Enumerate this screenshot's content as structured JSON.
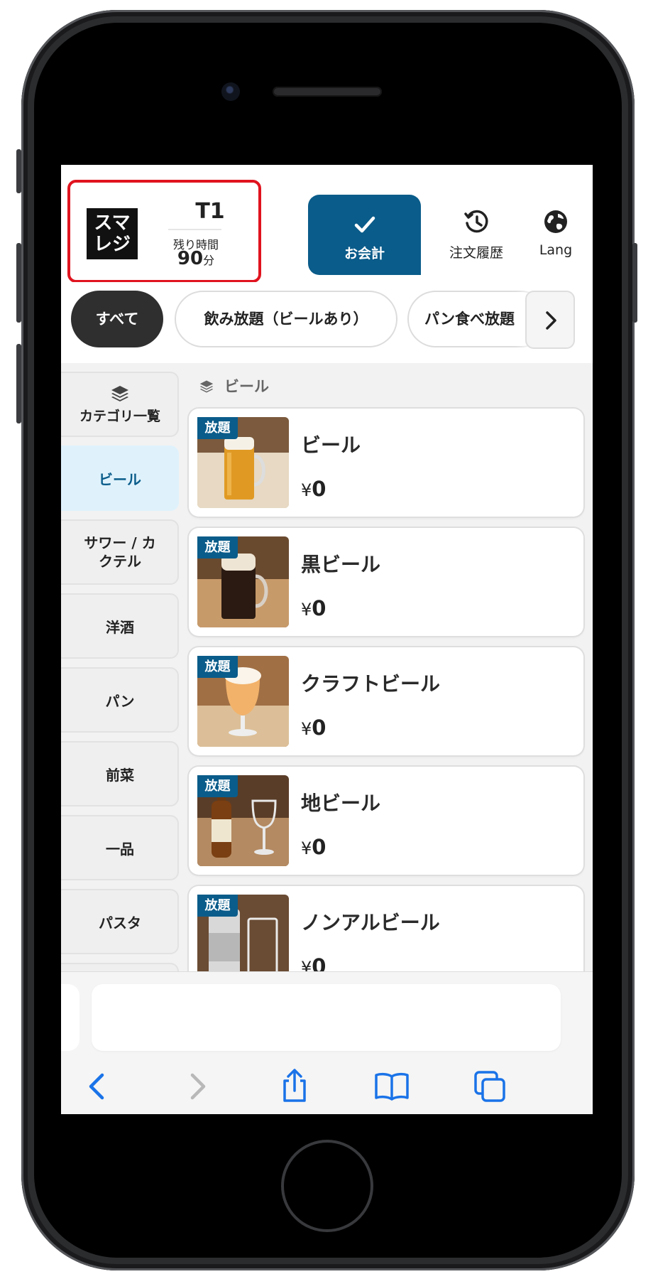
{
  "header": {
    "logo_text": "スマレジ",
    "table_id": "T1",
    "remaining_label": "残り時間",
    "remaining_value": "90",
    "remaining_unit": "分",
    "checkout_label": "お会計",
    "history_label": "注文履歴",
    "lang_label": "Lang",
    "icons": {
      "checkout": "check-icon",
      "history": "history-icon",
      "lang": "globe-icon"
    }
  },
  "tabs": [
    {
      "label": "すべて",
      "active": true
    },
    {
      "label": "飲み放題（ビールあり）",
      "active": false
    },
    {
      "label": "パン食べ放題",
      "active": false
    }
  ],
  "sidebar": {
    "items": [
      {
        "label": "カテゴリ一覧",
        "icon": "layers-icon"
      },
      {
        "label": "ビール",
        "active": true
      },
      {
        "label": "サワー / カクテル"
      },
      {
        "label": "洋酒"
      },
      {
        "label": "パン"
      },
      {
        "label": "前菜"
      },
      {
        "label": "一品"
      },
      {
        "label": "パスタ"
      }
    ]
  },
  "section": {
    "title": "ビール",
    "icon": "layers-icon"
  },
  "menu_items": [
    {
      "badge": "放題",
      "name": "ビール",
      "currency": "¥",
      "price": "0"
    },
    {
      "badge": "放題",
      "name": "黒ビール",
      "currency": "¥",
      "price": "0"
    },
    {
      "badge": "放題",
      "name": "クラフトビール",
      "currency": "¥",
      "price": "0"
    },
    {
      "badge": "放題",
      "name": "地ビール",
      "currency": "¥",
      "price": "0"
    },
    {
      "badge": "放題",
      "name": "ノンアルビール",
      "currency": "¥",
      "price": "0"
    }
  ],
  "browser_toolbar": {
    "icons": [
      "back-icon",
      "forward-icon",
      "share-icon",
      "bookmarks-icon",
      "tabs-icon"
    ]
  },
  "colors": {
    "accent": "#0a5c8a",
    "highlight_box": "#e0141f",
    "active_tab": "#2f2f2f",
    "sidebar_active_bg": "#dff2fc",
    "ios_blue": "#1a73e8"
  }
}
